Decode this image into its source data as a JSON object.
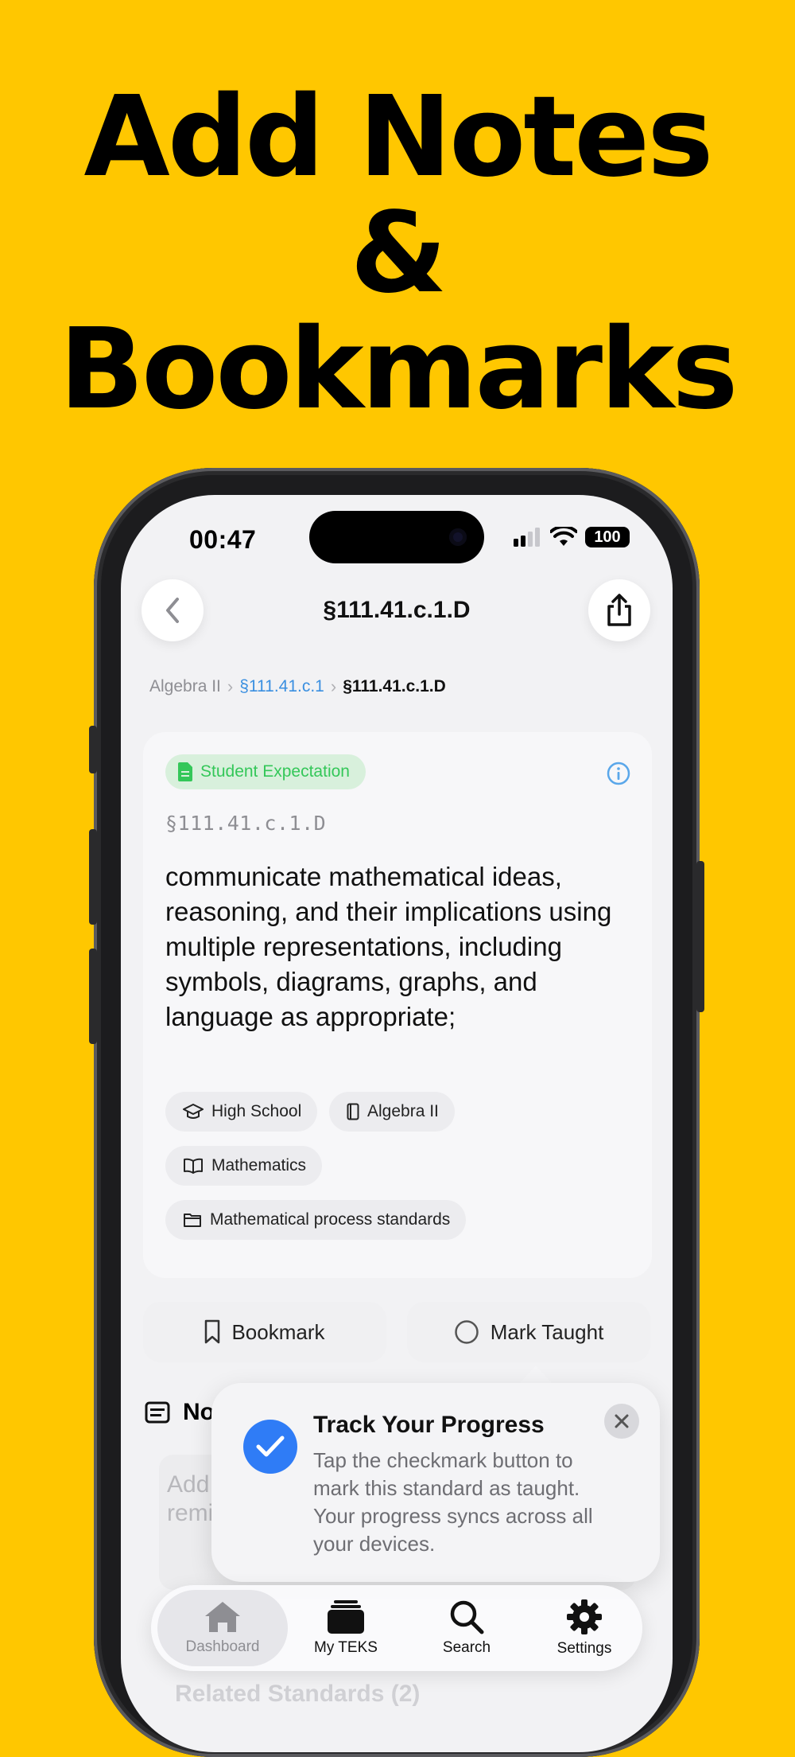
{
  "headline": {
    "line1": "Add Notes",
    "line2": "&",
    "line3": "Bookmarks"
  },
  "status_bar": {
    "time": "00:47",
    "battery": "100"
  },
  "nav": {
    "title": "§111.41.c.1.D"
  },
  "breadcrumb": {
    "items": [
      "Algebra II",
      "§111.41.c.1",
      "§111.41.c.1.D"
    ]
  },
  "standard": {
    "type_badge": "Student Expectation",
    "code": "§111.41.c.1.D",
    "text": "communicate mathematical ideas, reasoning, and their implications using multiple representations, including symbols, diagrams, graphs, and language as appropriate;",
    "tags": [
      "High School",
      "Algebra II",
      "Mathematics",
      "Mathematical process standards"
    ]
  },
  "actions": {
    "bookmark": "Bookmark",
    "mark_taught": "Mark Taught"
  },
  "notes": {
    "title": "No",
    "placeholder": "Add\nremi"
  },
  "related": {
    "title": "Related Standards (2)"
  },
  "tip": {
    "title": "Track Your Progress",
    "body": "Tap the checkmark button to mark this standard as taught. Your progress syncs across all your devices."
  },
  "tabbar": {
    "tabs": [
      "Dashboard",
      "My TEKS",
      "Search",
      "Settings"
    ]
  },
  "colors": {
    "background": "#FFC700",
    "accent": "#2F7CF6",
    "badge_green": "#34C759",
    "link_blue": "#3A8FE0"
  }
}
